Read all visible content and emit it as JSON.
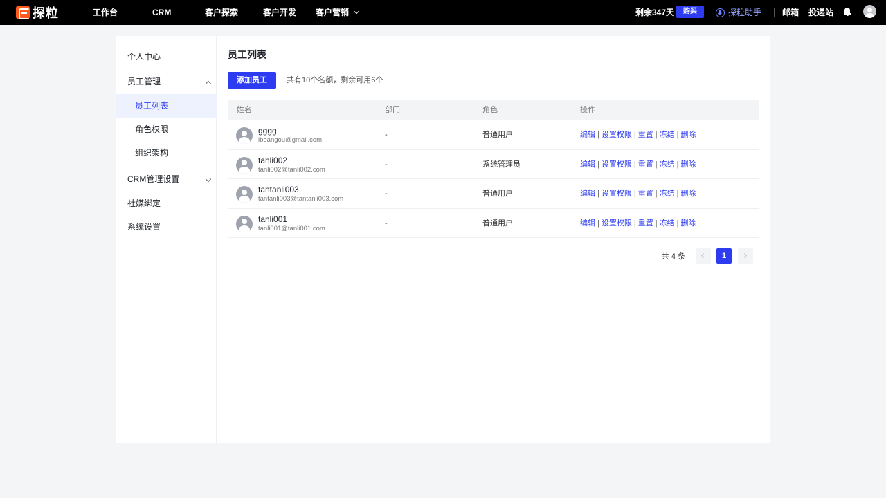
{
  "topbar": {
    "logo_text": "探粒",
    "nav": [
      {
        "label": "工作台"
      },
      {
        "label": "CRM"
      },
      {
        "label": "客户探索"
      },
      {
        "label": "客户开发"
      },
      {
        "label": "客户营销"
      }
    ],
    "remaining": "剩余347天",
    "buy_label": "购买",
    "assistant_label": "探粒助手",
    "mail_label": "邮箱",
    "delivery_label": "投递站"
  },
  "sidebar": {
    "items": [
      {
        "label": "个人中心"
      },
      {
        "label": "员工管理"
      },
      {
        "label": "员工列表"
      },
      {
        "label": "角色权限"
      },
      {
        "label": "组织架构"
      },
      {
        "label": "CRM管理设置"
      },
      {
        "label": "社媒绑定"
      },
      {
        "label": "系统设置"
      }
    ]
  },
  "main": {
    "title": "员工列表",
    "add_button": "添加员工",
    "quota_text": "共有10个名额，剩余可用6个",
    "columns": [
      "姓名",
      "部门",
      "角色",
      "操作"
    ],
    "rows": [
      {
        "name": "gggg",
        "email": "lbeangou@gmail.com",
        "dept": "-",
        "role": "普通用户"
      },
      {
        "name": "tanli002",
        "email": "tanli002@tanli002.com",
        "dept": "-",
        "role": "系统管理员"
      },
      {
        "name": "tantanli003",
        "email": "tantanli003@tantanli003.com",
        "dept": "-",
        "role": "普通用户"
      },
      {
        "name": "tanli001",
        "email": "tanli001@tanli001.com",
        "dept": "-",
        "role": "普通用户"
      }
    ],
    "actions": [
      "编辑",
      "设置权限",
      "重置",
      "冻结",
      "删除"
    ],
    "action_separator": "|",
    "pagination": {
      "total_text": "共 4 条",
      "current_page": "1"
    }
  },
  "colors": {
    "accent": "#2d3cf0",
    "topbar_bg": "#000000",
    "page_bg": "#f4f5f7"
  }
}
